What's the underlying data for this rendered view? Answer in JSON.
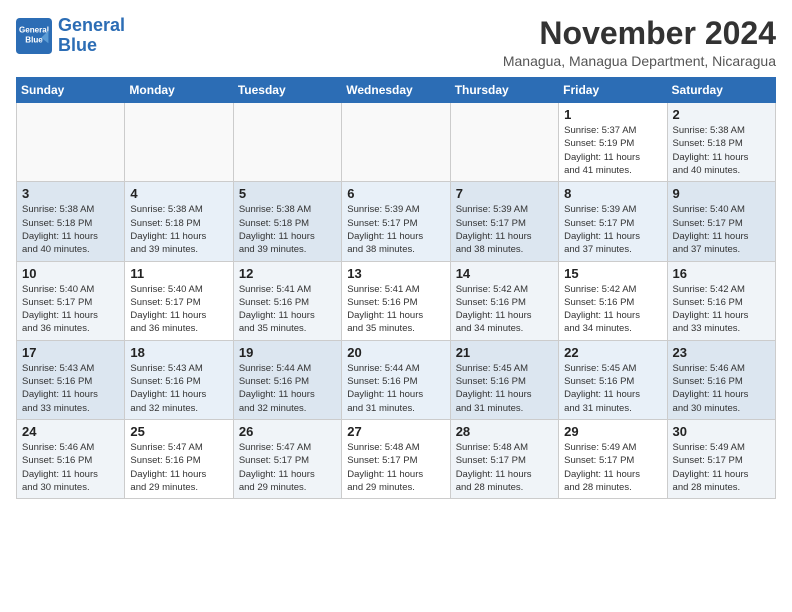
{
  "header": {
    "logo_line1": "General",
    "logo_line2": "Blue",
    "month_title": "November 2024",
    "subtitle": "Managua, Managua Department, Nicaragua"
  },
  "weekdays": [
    "Sunday",
    "Monday",
    "Tuesday",
    "Wednesday",
    "Thursday",
    "Friday",
    "Saturday"
  ],
  "rows": [
    [
      {
        "day": "",
        "info": ""
      },
      {
        "day": "",
        "info": ""
      },
      {
        "day": "",
        "info": ""
      },
      {
        "day": "",
        "info": ""
      },
      {
        "day": "",
        "info": ""
      },
      {
        "day": "1",
        "info": "Sunrise: 5:37 AM\nSunset: 5:19 PM\nDaylight: 11 hours\nand 41 minutes."
      },
      {
        "day": "2",
        "info": "Sunrise: 5:38 AM\nSunset: 5:18 PM\nDaylight: 11 hours\nand 40 minutes."
      }
    ],
    [
      {
        "day": "3",
        "info": "Sunrise: 5:38 AM\nSunset: 5:18 PM\nDaylight: 11 hours\nand 40 minutes."
      },
      {
        "day": "4",
        "info": "Sunrise: 5:38 AM\nSunset: 5:18 PM\nDaylight: 11 hours\nand 39 minutes."
      },
      {
        "day": "5",
        "info": "Sunrise: 5:38 AM\nSunset: 5:18 PM\nDaylight: 11 hours\nand 39 minutes."
      },
      {
        "day": "6",
        "info": "Sunrise: 5:39 AM\nSunset: 5:17 PM\nDaylight: 11 hours\nand 38 minutes."
      },
      {
        "day": "7",
        "info": "Sunrise: 5:39 AM\nSunset: 5:17 PM\nDaylight: 11 hours\nand 38 minutes."
      },
      {
        "day": "8",
        "info": "Sunrise: 5:39 AM\nSunset: 5:17 PM\nDaylight: 11 hours\nand 37 minutes."
      },
      {
        "day": "9",
        "info": "Sunrise: 5:40 AM\nSunset: 5:17 PM\nDaylight: 11 hours\nand 37 minutes."
      }
    ],
    [
      {
        "day": "10",
        "info": "Sunrise: 5:40 AM\nSunset: 5:17 PM\nDaylight: 11 hours\nand 36 minutes."
      },
      {
        "day": "11",
        "info": "Sunrise: 5:40 AM\nSunset: 5:17 PM\nDaylight: 11 hours\nand 36 minutes."
      },
      {
        "day": "12",
        "info": "Sunrise: 5:41 AM\nSunset: 5:16 PM\nDaylight: 11 hours\nand 35 minutes."
      },
      {
        "day": "13",
        "info": "Sunrise: 5:41 AM\nSunset: 5:16 PM\nDaylight: 11 hours\nand 35 minutes."
      },
      {
        "day": "14",
        "info": "Sunrise: 5:42 AM\nSunset: 5:16 PM\nDaylight: 11 hours\nand 34 minutes."
      },
      {
        "day": "15",
        "info": "Sunrise: 5:42 AM\nSunset: 5:16 PM\nDaylight: 11 hours\nand 34 minutes."
      },
      {
        "day": "16",
        "info": "Sunrise: 5:42 AM\nSunset: 5:16 PM\nDaylight: 11 hours\nand 33 minutes."
      }
    ],
    [
      {
        "day": "17",
        "info": "Sunrise: 5:43 AM\nSunset: 5:16 PM\nDaylight: 11 hours\nand 33 minutes."
      },
      {
        "day": "18",
        "info": "Sunrise: 5:43 AM\nSunset: 5:16 PM\nDaylight: 11 hours\nand 32 minutes."
      },
      {
        "day": "19",
        "info": "Sunrise: 5:44 AM\nSunset: 5:16 PM\nDaylight: 11 hours\nand 32 minutes."
      },
      {
        "day": "20",
        "info": "Sunrise: 5:44 AM\nSunset: 5:16 PM\nDaylight: 11 hours\nand 31 minutes."
      },
      {
        "day": "21",
        "info": "Sunrise: 5:45 AM\nSunset: 5:16 PM\nDaylight: 11 hours\nand 31 minutes."
      },
      {
        "day": "22",
        "info": "Sunrise: 5:45 AM\nSunset: 5:16 PM\nDaylight: 11 hours\nand 31 minutes."
      },
      {
        "day": "23",
        "info": "Sunrise: 5:46 AM\nSunset: 5:16 PM\nDaylight: 11 hours\nand 30 minutes."
      }
    ],
    [
      {
        "day": "24",
        "info": "Sunrise: 5:46 AM\nSunset: 5:16 PM\nDaylight: 11 hours\nand 30 minutes."
      },
      {
        "day": "25",
        "info": "Sunrise: 5:47 AM\nSunset: 5:16 PM\nDaylight: 11 hours\nand 29 minutes."
      },
      {
        "day": "26",
        "info": "Sunrise: 5:47 AM\nSunset: 5:17 PM\nDaylight: 11 hours\nand 29 minutes."
      },
      {
        "day": "27",
        "info": "Sunrise: 5:48 AM\nSunset: 5:17 PM\nDaylight: 11 hours\nand 29 minutes."
      },
      {
        "day": "28",
        "info": "Sunrise: 5:48 AM\nSunset: 5:17 PM\nDaylight: 11 hours\nand 28 minutes."
      },
      {
        "day": "29",
        "info": "Sunrise: 5:49 AM\nSunset: 5:17 PM\nDaylight: 11 hours\nand 28 minutes."
      },
      {
        "day": "30",
        "info": "Sunrise: 5:49 AM\nSunset: 5:17 PM\nDaylight: 11 hours\nand 28 minutes."
      }
    ]
  ]
}
